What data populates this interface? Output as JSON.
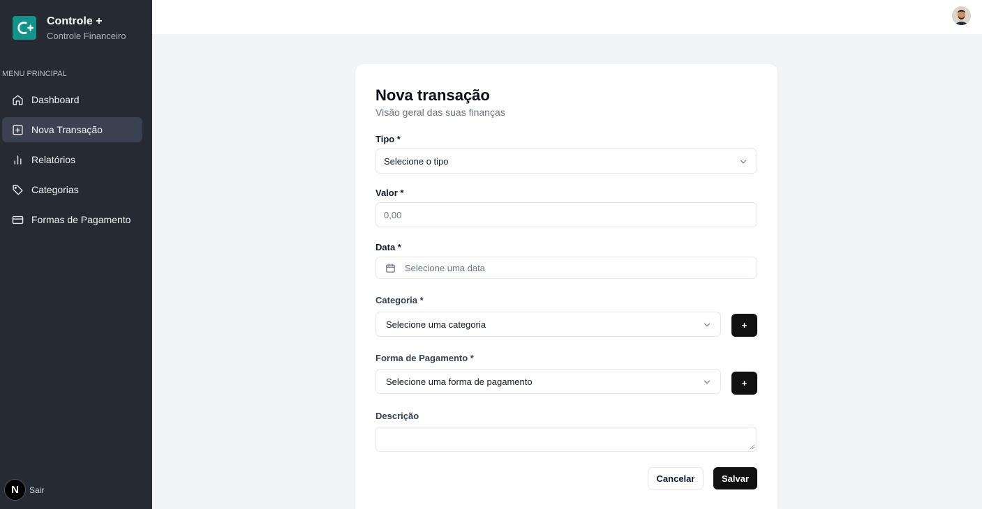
{
  "brand": {
    "title": "Controle +",
    "subtitle": "Controle Financeiro"
  },
  "sidebar": {
    "section_label": "MENU PRINCIPAL",
    "items": [
      {
        "label": "Dashboard",
        "icon": "home-icon",
        "active": false
      },
      {
        "label": "Nova Transação",
        "icon": "plus-square-icon",
        "active": true
      },
      {
        "label": "Relatórios",
        "icon": "bar-chart-icon",
        "active": false
      },
      {
        "label": "Categorias",
        "icon": "tag-icon",
        "active": false
      },
      {
        "label": "Formas de Pagamento",
        "icon": "credit-card-icon",
        "active": false
      }
    ],
    "logout": {
      "badge": "N",
      "label": "Sair"
    }
  },
  "form": {
    "title": "Nova transação",
    "subtitle": "Visão geral das suas finanças",
    "tipo": {
      "label": "Tipo *",
      "value": "Selecione o tipo"
    },
    "valor": {
      "label": "Valor *",
      "placeholder": "0,00"
    },
    "data": {
      "label": "Data *",
      "placeholder": "Selecione uma data"
    },
    "categoria": {
      "label": "Categoria *",
      "value": "Selecione uma categoria",
      "add_label": "+"
    },
    "pagamento": {
      "label": "Forma de Pagamento *",
      "value": "Selecione uma forma de pagamento",
      "add_label": "+"
    },
    "descricao": {
      "label": "Descrição",
      "value": ""
    },
    "cancel_label": "Cancelar",
    "save_label": "Salvar"
  },
  "colors": {
    "sidebar_bg": "#252a33",
    "active_bg": "#3a4251",
    "brand_accent": "#13938a",
    "primary_button": "#111111",
    "page_bg": "#f3f4f6"
  }
}
